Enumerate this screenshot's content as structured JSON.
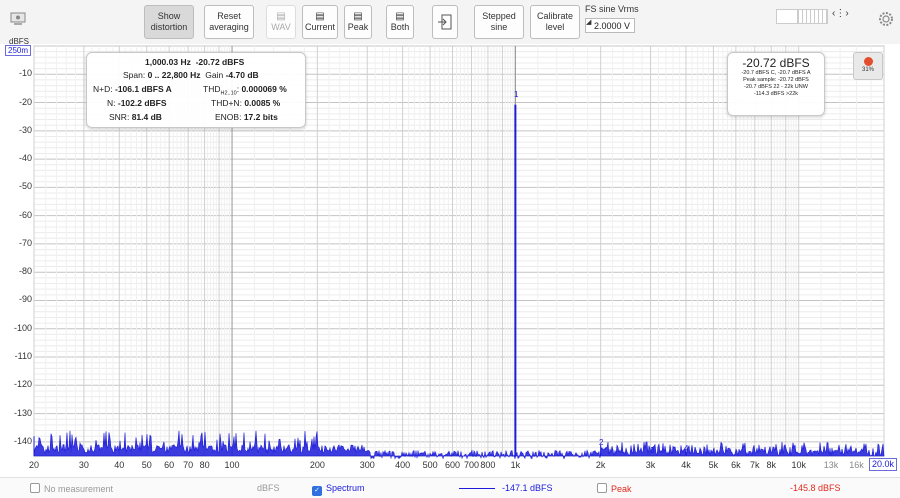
{
  "toolbar": {
    "show_distortion": "Show\ndistortion",
    "reset_averaging": "Reset\naveraging",
    "wav": "WAV",
    "current": "Current",
    "peak": "Peak",
    "both": "Both",
    "stepped_sine": "Stepped\nsine",
    "calibrate_level": "Calibrate\nlevel",
    "fs_sine_label": "FS sine Vrms",
    "fs_sine_value": "2.0000 V"
  },
  "plot": {
    "y_unit": "dBFS",
    "y_range": "250m",
    "y_ticks": [
      "-10",
      "-20",
      "-30",
      "-40",
      "-50",
      "-60",
      "-70",
      "-80",
      "-90",
      "-100",
      "-110",
      "-120",
      "-130",
      "-140"
    ],
    "x_ticks": [
      "20",
      "30",
      "40",
      "50",
      "60",
      "70",
      "80",
      "100",
      "200",
      "300",
      "400",
      "500",
      "600",
      "700",
      "800",
      "1k",
      "2k",
      "3k",
      "4k",
      "5k",
      "6k",
      "7k",
      "8k",
      "10k",
      "13k",
      "16k"
    ],
    "x_ticks_gray": [
      "13k",
      "16k"
    ],
    "x_max": "20.0k",
    "peak_labels": [
      "1",
      "2",
      "3",
      "4"
    ]
  },
  "info": {
    "freq": "1,000.03 Hz",
    "level": "-20.72 dBFS",
    "span_label": "Span:",
    "span_value": "0 .. 22,800 Hz",
    "gain_label": "Gain",
    "gain_value": "-4.70 dB",
    "nd_label": "N+D:",
    "nd_value": "-106.1 dBFS A",
    "thd_label": "THD",
    "thd_sub": "H2..10",
    "thd_value": "0.000069 %",
    "n_label": "N:",
    "n_value": "-102.2 dBFS",
    "thdn_label": "THD+N:",
    "thdn_value": "0.0085 %",
    "snr_label": "SNR:",
    "snr_value": "81.4 dB",
    "enob_label": "ENOB:",
    "enob_value": "17.2 bits"
  },
  "level_box": {
    "big": "-20.72 dBFS",
    "line1": "-20.7 dBFS C, -20.7 dBFS A",
    "line2": "Peak sample: -20.72 dBFS",
    "line3": "-20.7 dBFS 22 - 22k UNW",
    "line4": "-114.3 dBFS >22k"
  },
  "record": {
    "pct": "31%"
  },
  "footer": {
    "no_measurement": "No measurement",
    "unit": "dBFS",
    "spectrum": "Spectrum",
    "spectrum_value": "-147.1 dBFS",
    "peak": "Peak",
    "peak_value": "-145.8 dBFS"
  },
  "colors": {
    "spectrum": "#1b1bd9",
    "peak": "#e0281e",
    "record": "#e44d2c"
  },
  "chart_data": {
    "type": "line",
    "title": "",
    "xlabel": "",
    "ylabel": "dBFS",
    "x_scale": "log",
    "xlim": [
      20,
      20000
    ],
    "ylim": [
      -145,
      0
    ],
    "grid": true,
    "series": [
      {
        "name": "Spectrum",
        "x": [
          20,
          1000,
          2000,
          3000,
          4000
        ],
        "values": [
          -138,
          -20.72,
          -141,
          -145,
          -143
        ]
      }
    ]
  }
}
